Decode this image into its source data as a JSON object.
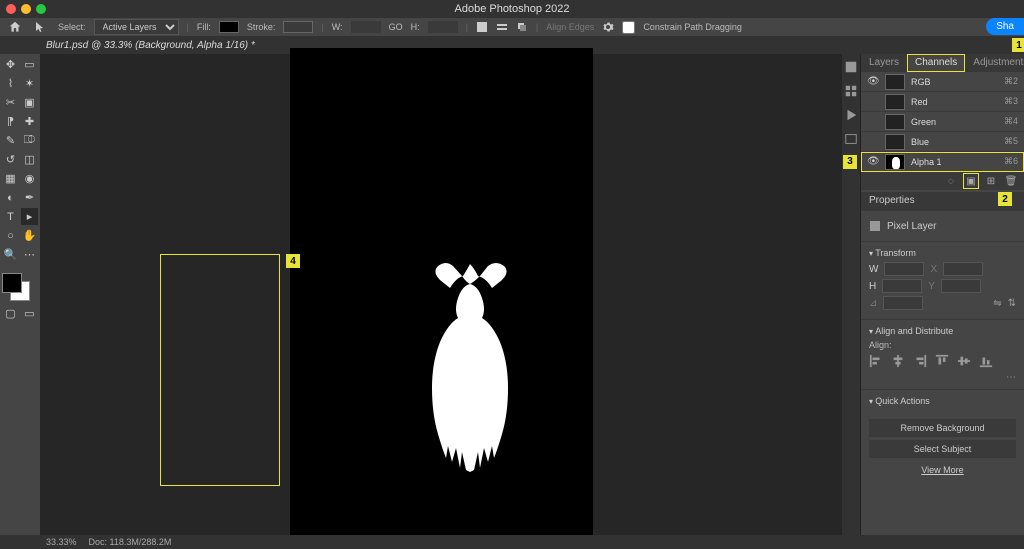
{
  "app_title": "Adobe Photoshop 2022",
  "doc_tab": "Blur1.psd @ 33.3% (Background, Alpha 1/16) *",
  "options_bar": {
    "select_label": "Select:",
    "select_value": "Active Layers",
    "fill_label": "Fill:",
    "stroke_label": "Stroke:",
    "w_label": "W:",
    "go_label": "GO",
    "h_label": "H:",
    "align_edges": "Align Edges",
    "constrain": "Constrain Path Dragging"
  },
  "share_label": "Sha",
  "callouts": {
    "c1": "1",
    "c2": "2",
    "c3": "3",
    "c4": "4"
  },
  "channels": {
    "tabs": {
      "layers": "Layers",
      "channels": "Channels",
      "adjustments": "Adjustments"
    },
    "rows": [
      {
        "name": "RGB",
        "key": "⌘2",
        "eye": true
      },
      {
        "name": "Red",
        "key": "⌘3",
        "eye": false
      },
      {
        "name": "Green",
        "key": "⌘4",
        "eye": false
      },
      {
        "name": "Blue",
        "key": "⌘5",
        "eye": false
      },
      {
        "name": "Alpha 1",
        "key": "⌘6",
        "eye": true,
        "alpha": true
      }
    ]
  },
  "properties": {
    "title": "Properties",
    "pixel_layer": "Pixel Layer",
    "transform": "Transform",
    "w": "W",
    "h": "H",
    "align_dist": "Align and Distribute",
    "align": "Align:",
    "quick_actions": "Quick Actions",
    "remove_bg": "Remove Background",
    "select_subject": "Select Subject",
    "view_more": "View More"
  },
  "status": {
    "zoom": "33.33%",
    "doc": "Doc: 118.3M/288.2M"
  }
}
